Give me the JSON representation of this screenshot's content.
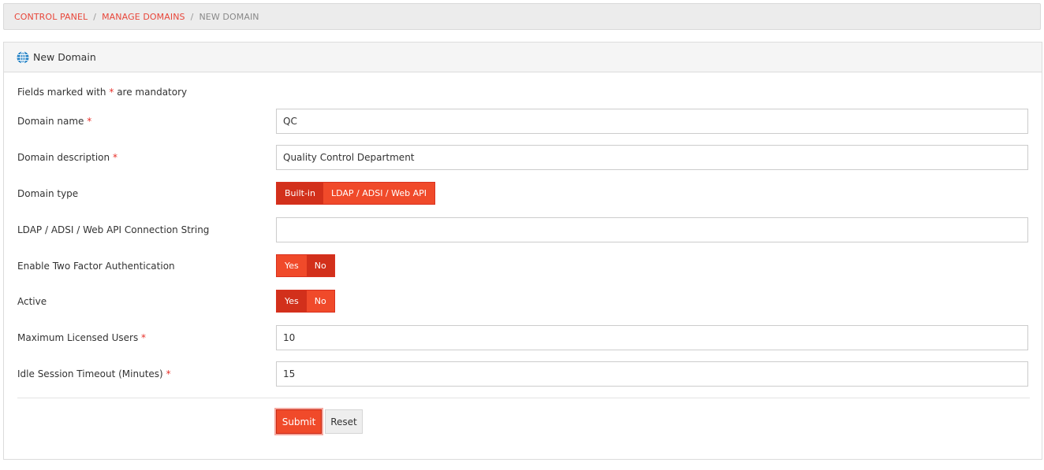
{
  "breadcrumb": {
    "items": [
      "CONTROL PANEL",
      "MANAGE DOMAINS"
    ],
    "separator": "/",
    "current": "NEW DOMAIN"
  },
  "panel": {
    "title": "New Domain",
    "icon": "globe-icon"
  },
  "form": {
    "mandatory_note_prefix": "Fields marked with",
    "mandatory_star": "*",
    "mandatory_note_suffix": "are mandatory",
    "domain_name": {
      "label": "Domain name",
      "required": "*",
      "value": "QC"
    },
    "domain_description": {
      "label": "Domain description",
      "required": "*",
      "value": "Quality Control Department"
    },
    "domain_type": {
      "label": "Domain type",
      "options": [
        "Built-in",
        "LDAP / ADSI / Web API"
      ],
      "selected": "Built-in"
    },
    "connection_string": {
      "label": "LDAP / ADSI / Web API Connection String",
      "value": ""
    },
    "two_factor": {
      "label": "Enable Two Factor Authentication",
      "options": [
        "Yes",
        "No"
      ],
      "selected": "No"
    },
    "active": {
      "label": "Active",
      "options": [
        "Yes",
        "No"
      ],
      "selected": "Yes"
    },
    "max_users": {
      "label": "Maximum Licensed Users",
      "required": "*",
      "value": "10"
    },
    "idle_timeout": {
      "label": "Idle Session Timeout (Minutes)",
      "required": "*",
      "value": "15"
    },
    "submit_label": "Submit",
    "reset_label": "Reset"
  },
  "colors": {
    "accent": "#f04a2a",
    "accent_selected": "#d2301b",
    "link": "#e8463a"
  }
}
